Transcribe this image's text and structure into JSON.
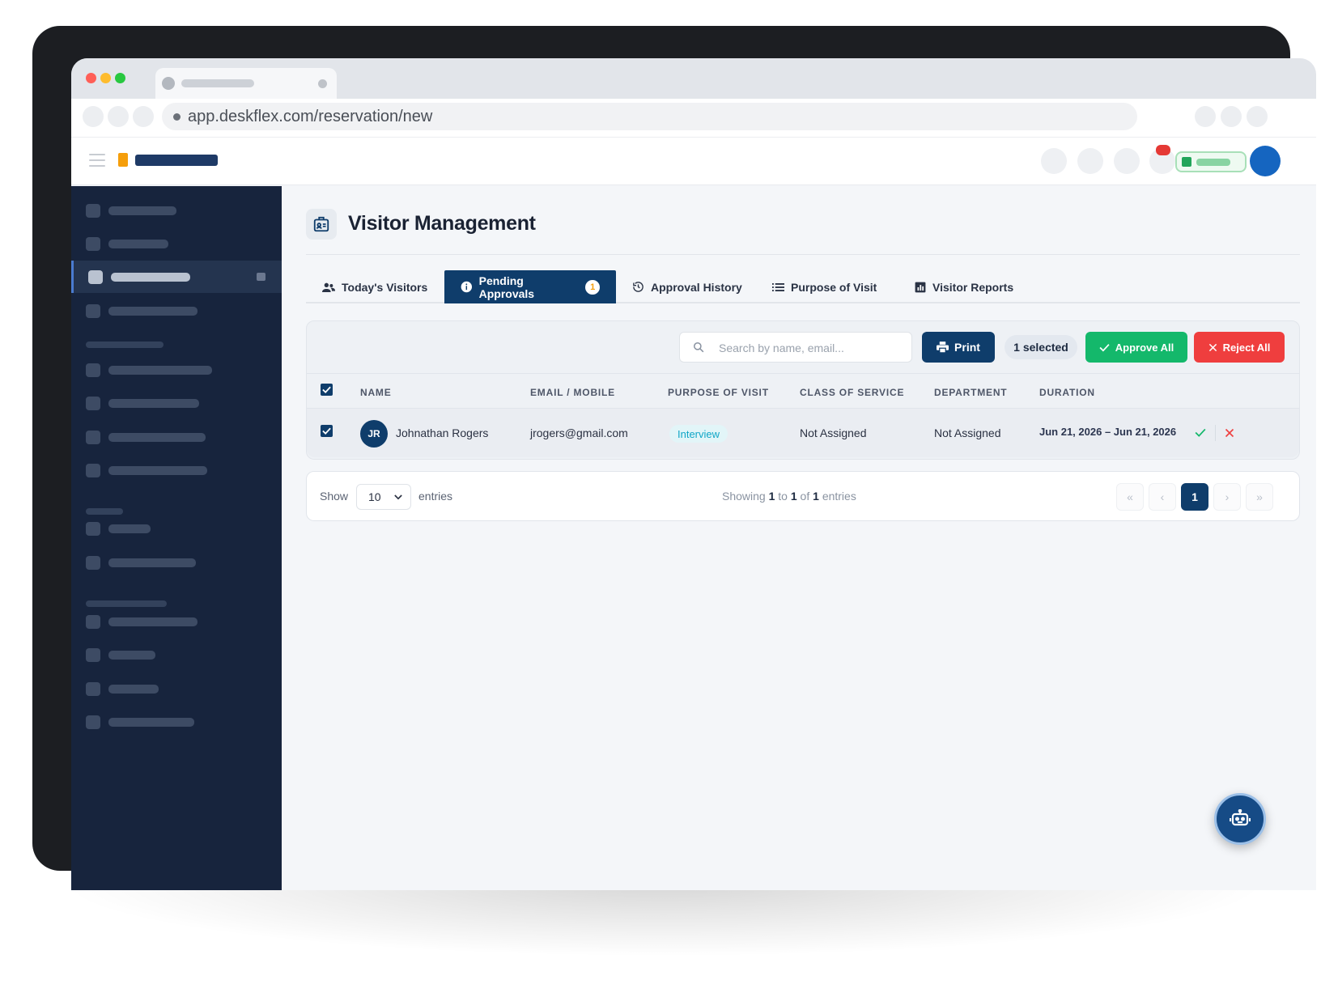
{
  "browser": {
    "url": "app.deskflex.com/reservation/new"
  },
  "page": {
    "title": "Visitor Management"
  },
  "tabs": [
    {
      "label": "Today's Visitors",
      "icon": "people-icon",
      "active": false
    },
    {
      "label": "Pending Approvals",
      "icon": "info-icon",
      "active": true,
      "badge": "1"
    },
    {
      "label": "Approval History",
      "icon": "history-icon",
      "active": false
    },
    {
      "label": "Purpose of Visit",
      "icon": "list-icon",
      "active": false
    },
    {
      "label": "Visitor Reports",
      "icon": "report-icon",
      "active": false
    }
  ],
  "toolbar": {
    "search_placeholder": "Search by name, email...",
    "print_label": "Print",
    "selected_label": "1 selected",
    "approve_all_label": "Approve All",
    "reject_all_label": "Reject All"
  },
  "table": {
    "headers": [
      "NAME",
      "EMAIL / MOBILE",
      "PURPOSE OF VISIT",
      "CLASS OF SERVICE",
      "DEPARTMENT",
      "DURATION"
    ],
    "rows": [
      {
        "initials": "JR",
        "name": "Johnathan Rogers",
        "email": "jrogers@gmail.com",
        "purpose": "Interview",
        "class_of_service": "Not Assigned",
        "department": "Not Assigned",
        "duration": "Jun 21, 2026 – Jun 21, 2026",
        "checked": true
      }
    ]
  },
  "pagination": {
    "show_label": "Show",
    "page_size": "10",
    "entries_label": "entries",
    "showing_prefix": "Showing",
    "from": "1",
    "to_label": "to",
    "to": "1",
    "of_label": "of",
    "total": "1",
    "entries_suffix": "entries",
    "current_page": "1",
    "first": "«",
    "prev": "‹",
    "next": "›",
    "last": "»"
  },
  "colors": {
    "brand_navy": "#0f3d6b",
    "approve_green": "#14b86b",
    "reject_red": "#ef3e3e",
    "sidebar_bg": "#17243d",
    "logo_orange": "#f59e0b"
  }
}
